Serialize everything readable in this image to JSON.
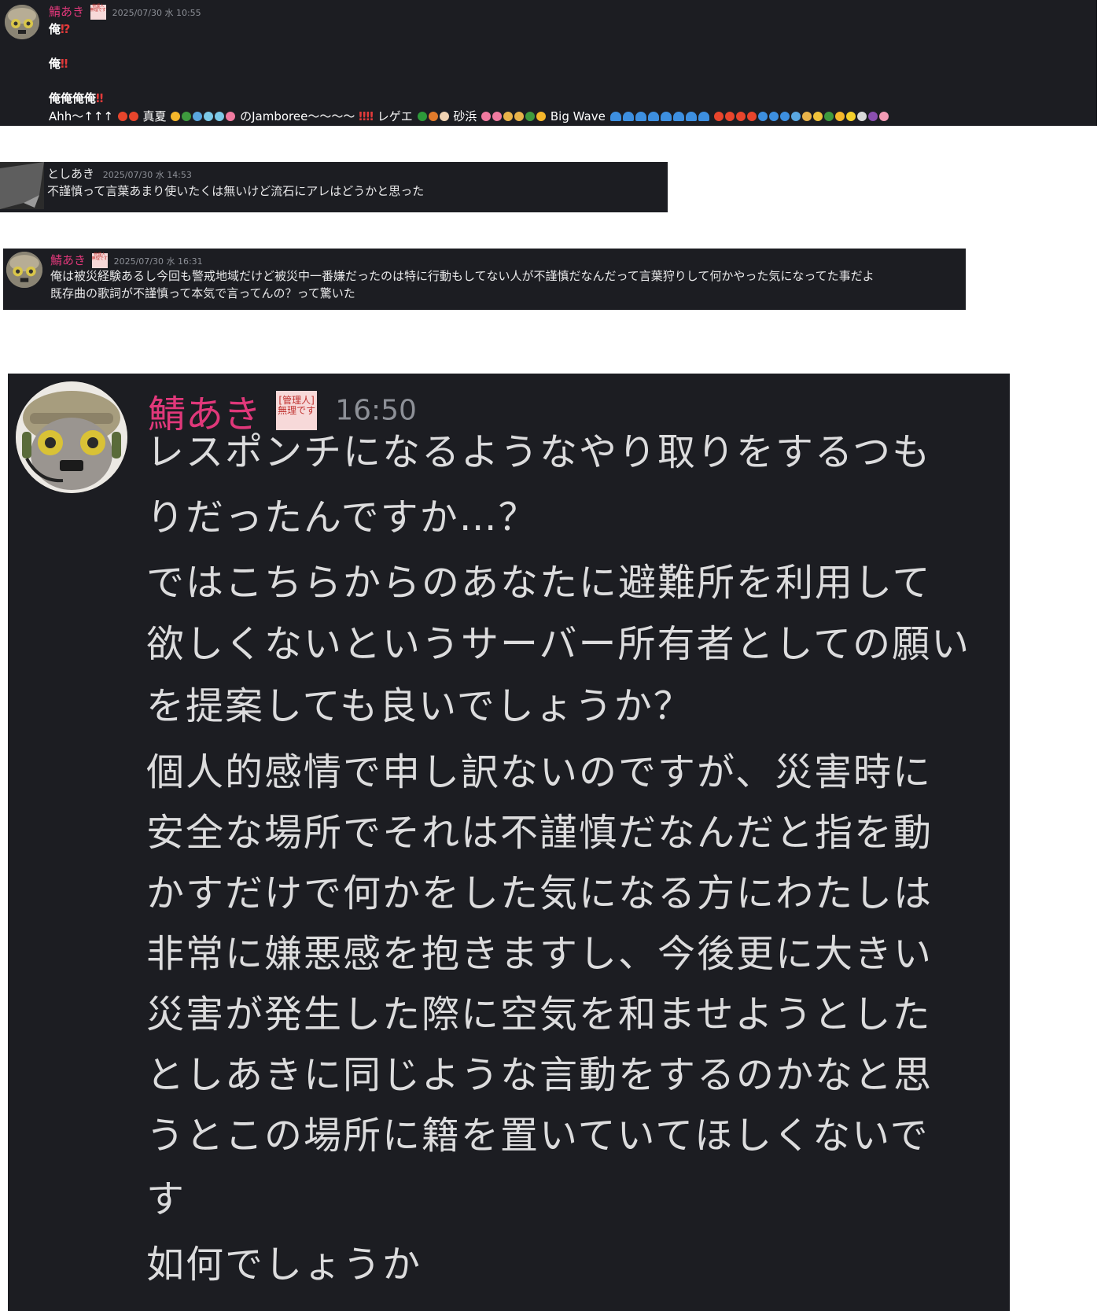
{
  "messages": [
    {
      "username": "鯖あき",
      "badge": "管理人\n無理です",
      "timestamp": "2025/07/30 水 10:55",
      "lines": [
        "俺",
        "俺",
        "俺俺俺俺"
      ],
      "marks": [
        "⁉",
        "‼",
        "‼"
      ],
      "last_line": {
        "part1": "Ahh〜↑↑↑",
        "part2": "真夏",
        "part3": "のJamboree〜〜〜〜",
        "part4": "レゲエ",
        "part5": "砂浜",
        "part6": "Big Wave"
      }
    },
    {
      "username": "としあき",
      "timestamp": "2025/07/30 水 14:53",
      "text": "不謹慎って言葉あまり使いたくは無いけど流石にアレはどうかと思った"
    },
    {
      "username": "鯖あき",
      "badge": "管理人\n無理です",
      "timestamp": "2025/07/30 水 16:31",
      "text_lines": [
        "俺は被災経験あるし今回も警戒地域だけど被災中一番嫌だったのは特に行動もしてない人が不謹慎だなんだって言葉狩りして何かやった気になってた事だよ",
        "既存曲の歌詞が不謹慎って本気で言ってんの？って驚いた"
      ]
    },
    {
      "username": "鯖あき",
      "badge": "[管理人]\n無理です",
      "timestamp": "16:50",
      "lines": [
        "レスポンチになるようなやり取りをするつも",
        "りだったんですか…？",
        "ではこちらからのあなたに避難所を利用して",
        "欲しくないというサーバー所有者としての願い",
        "を提案しても良いでしょうか？",
        "個人的感情で申し訳ないのですが、災害時に",
        "安全な場所でそれは不謹慎だなんだと指を動",
        "かすだけで何かをした気になる方にわたしは",
        "非常に嫌悪感を抱きますし、今後更に大きい",
        "災害が発生した際に空気を和ませようとした",
        "としあきに同じような言動をするのかなと思",
        "うとこの場所に籍を置いていてほしくないで",
        "す",
        "如何でしょうか"
      ]
    }
  ],
  "colors": {
    "background": "#1c1d22",
    "username": "#e0387a",
    "timestamp": "#8d9097",
    "text": "#e9e9ea"
  },
  "icons": [
    "avatar-helmet-icon",
    "avatar-gray-icon",
    "emoji-icons",
    "wave-emoji-icon"
  ]
}
